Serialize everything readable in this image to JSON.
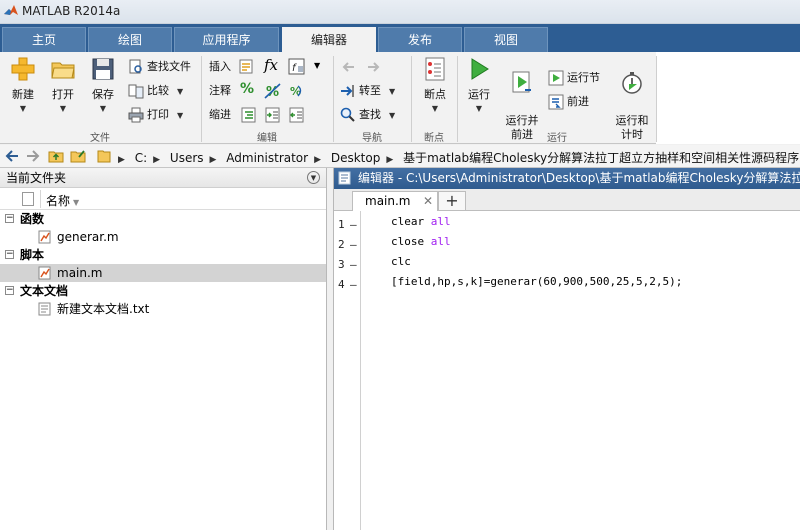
{
  "window": {
    "title": "MATLAB R2014a"
  },
  "tabs": [
    {
      "label": "主页",
      "active": false
    },
    {
      "label": "绘图",
      "active": false
    },
    {
      "label": "应用程序",
      "active": false
    },
    {
      "label": "编辑器",
      "active": true
    },
    {
      "label": "发布",
      "active": false
    },
    {
      "label": "视图",
      "active": false
    }
  ],
  "ribbon": {
    "file": {
      "label": "文件",
      "new": "新建",
      "open": "打开",
      "save": "保存",
      "find_files": "查找文件",
      "compare": "比较",
      "print": "打印"
    },
    "edit": {
      "label": "编辑",
      "insert": "插入",
      "comment": "注释",
      "indent": "缩进"
    },
    "navigate": {
      "label": "导航",
      "goto": "转至",
      "find": "查找"
    },
    "breakpoints": {
      "label": "断点",
      "breakpoints": "断点"
    },
    "run": {
      "label": "运行",
      "run": "运行",
      "run_advance": "运行并\n前进",
      "run_section": "运行节",
      "advance": "前进",
      "run_time": "运行和\n计时"
    }
  },
  "address": {
    "crumbs": [
      "C:",
      "Users",
      "Administrator",
      "Desktop",
      "基于matlab编程Cholesky分解算法拉丁超立方抽样和空间相关性源码程序"
    ]
  },
  "current_folder": {
    "title": "当前文件夹",
    "column_name": "名称",
    "groups": [
      {
        "label": "函数",
        "items": [
          {
            "name": "generar.m",
            "selected": false
          }
        ]
      },
      {
        "label": "脚本",
        "items": [
          {
            "name": "main.m",
            "selected": true
          }
        ]
      },
      {
        "label": "文本文档",
        "items": [
          {
            "name": "新建文本文档.txt",
            "selected": false
          }
        ]
      }
    ]
  },
  "editor": {
    "title": "编辑器 - C:\\Users\\Administrator\\Desktop\\基于matlab编程Cholesky分解算法拉丁超立方抽样和空间相关性源码程序\\main.m",
    "tab_label": "main.m",
    "lines": [
      {
        "num": "1",
        "dash": "–",
        "code": "clear",
        "arg": "all"
      },
      {
        "num": "2",
        "dash": "–",
        "code": "close",
        "arg": "all"
      },
      {
        "num": "3",
        "dash": "–",
        "code": "clc",
        "arg": ""
      },
      {
        "num": "4",
        "dash": "–",
        "code": "[field,hp,s,k]=generar(60,900,500,25,5,2,5);",
        "arg": ""
      }
    ]
  },
  "colors": {
    "tab_strip": "#2d5d93",
    "tab": "#4f7bab",
    "editor_header": "#3a669b",
    "keyword_string": "#a020f0",
    "selected_row": "#d3d3d3"
  }
}
